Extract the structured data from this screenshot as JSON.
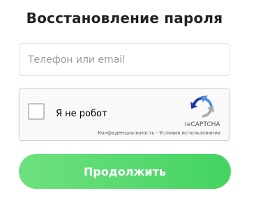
{
  "page": {
    "title": "Восстановление пароля"
  },
  "form": {
    "login_input": {
      "placeholder": "Телефон или email",
      "value": ""
    },
    "recaptcha": {
      "checkbox_label": "Я не робот",
      "brand": "reCAPTCHA",
      "privacy_link": "Конфиденциальность",
      "separator": " - ",
      "terms_link": "Условия использования",
      "icon": "recaptcha-logo-icon"
    },
    "submit_label": "Продолжить"
  },
  "colors": {
    "button_start": "#6fe080",
    "button_end": "#43d460",
    "title": "#222222",
    "recaptcha_blue": "#1c3aa9",
    "recaptcha_light_blue": "#4a90e2",
    "recaptcha_gray": "#ababab"
  }
}
